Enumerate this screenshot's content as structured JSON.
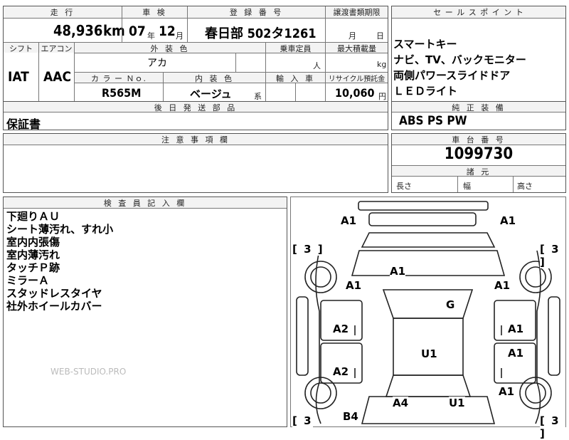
{
  "main_table": {
    "headers": {
      "mileage": "走 行",
      "inspection": "車 検",
      "registration": "登 録 番 号",
      "transfer_deadline": "譲渡書類期限",
      "shift": "シフト",
      "aircon": "エアコン",
      "exterior_color": "外 装 色",
      "capacity": "乗車定員",
      "max_load": "最大積載量",
      "color_no": "カ ラ ー Ｎｏ.",
      "interior_color": "内 装 色",
      "import": "輸 入 車",
      "recycle": "リサイクル預託金"
    },
    "mileage_value": "48,936",
    "mileage_unit": "km",
    "inspection_year": "07",
    "inspection_year_unit": "年",
    "inspection_month": "12",
    "inspection_month_unit": "月",
    "registration_value": "春日部 502タ1261",
    "transfer_month_unit": "月",
    "transfer_day_unit": "日",
    "shift_value": "IAT",
    "aircon_value": "AAC",
    "exterior_color_value": "アカ",
    "capacity_unit": "人",
    "max_load_unit": "kg",
    "color_no_value": "R565M",
    "interior_color_value": "ベージュ",
    "interior_suffix": "系",
    "recycle_value": "10,060",
    "recycle_unit": "円"
  },
  "selling_points": {
    "header": "セ ー ル ス ポ イ ン ト",
    "items": [
      "スマートキー",
      "ナビ、TV、バックモニター",
      "両側パワースライドドア",
      "ＬＥＤライト"
    ]
  },
  "post_shipping": {
    "header": "後 日 発 送 部 品",
    "value": "保証書"
  },
  "genuine_equipment": {
    "header": "純 正 装 備",
    "value": "ABS PS PW"
  },
  "notes": {
    "header": "注 意 事 項 欄",
    "value": ""
  },
  "chassis": {
    "header": "車 台 番 号",
    "value": "1099730"
  },
  "dimensions": {
    "header": "諸 元",
    "length": "長さ",
    "width": "幅",
    "height": "高さ"
  },
  "inspector": {
    "header": "検 査 員 記 入 欄",
    "items": [
      "下廻りＡＵ",
      "シート薄汚れ、すれ小",
      "室内内張傷",
      "室内薄汚れ",
      "タッチＰ跡",
      "ミラーＡ",
      "スタッドレスタイヤ",
      "社外ホイールカバー"
    ],
    "watermark": "WEB-STUDIO.PRO"
  },
  "diagram": {
    "marks": {
      "front_left": "A1",
      "front_right": "A1",
      "tire_fl": "[ 3 ]",
      "tire_fr": "[ 3 ]",
      "tire_rl": "[ 3",
      "tire_rr": "[ 3 ]",
      "hood": "A1",
      "fender_left": "A1",
      "fender_right": "A1",
      "windshield": "G",
      "door_left_front": "A2",
      "door_right_front": "A1",
      "door_left_rear": "A2",
      "door_right_rear": "A1",
      "roof": "U1",
      "quarter_right": "A1",
      "rear_left": "A4",
      "rear_center": "U1",
      "rear_bumper_left": "B4"
    }
  }
}
